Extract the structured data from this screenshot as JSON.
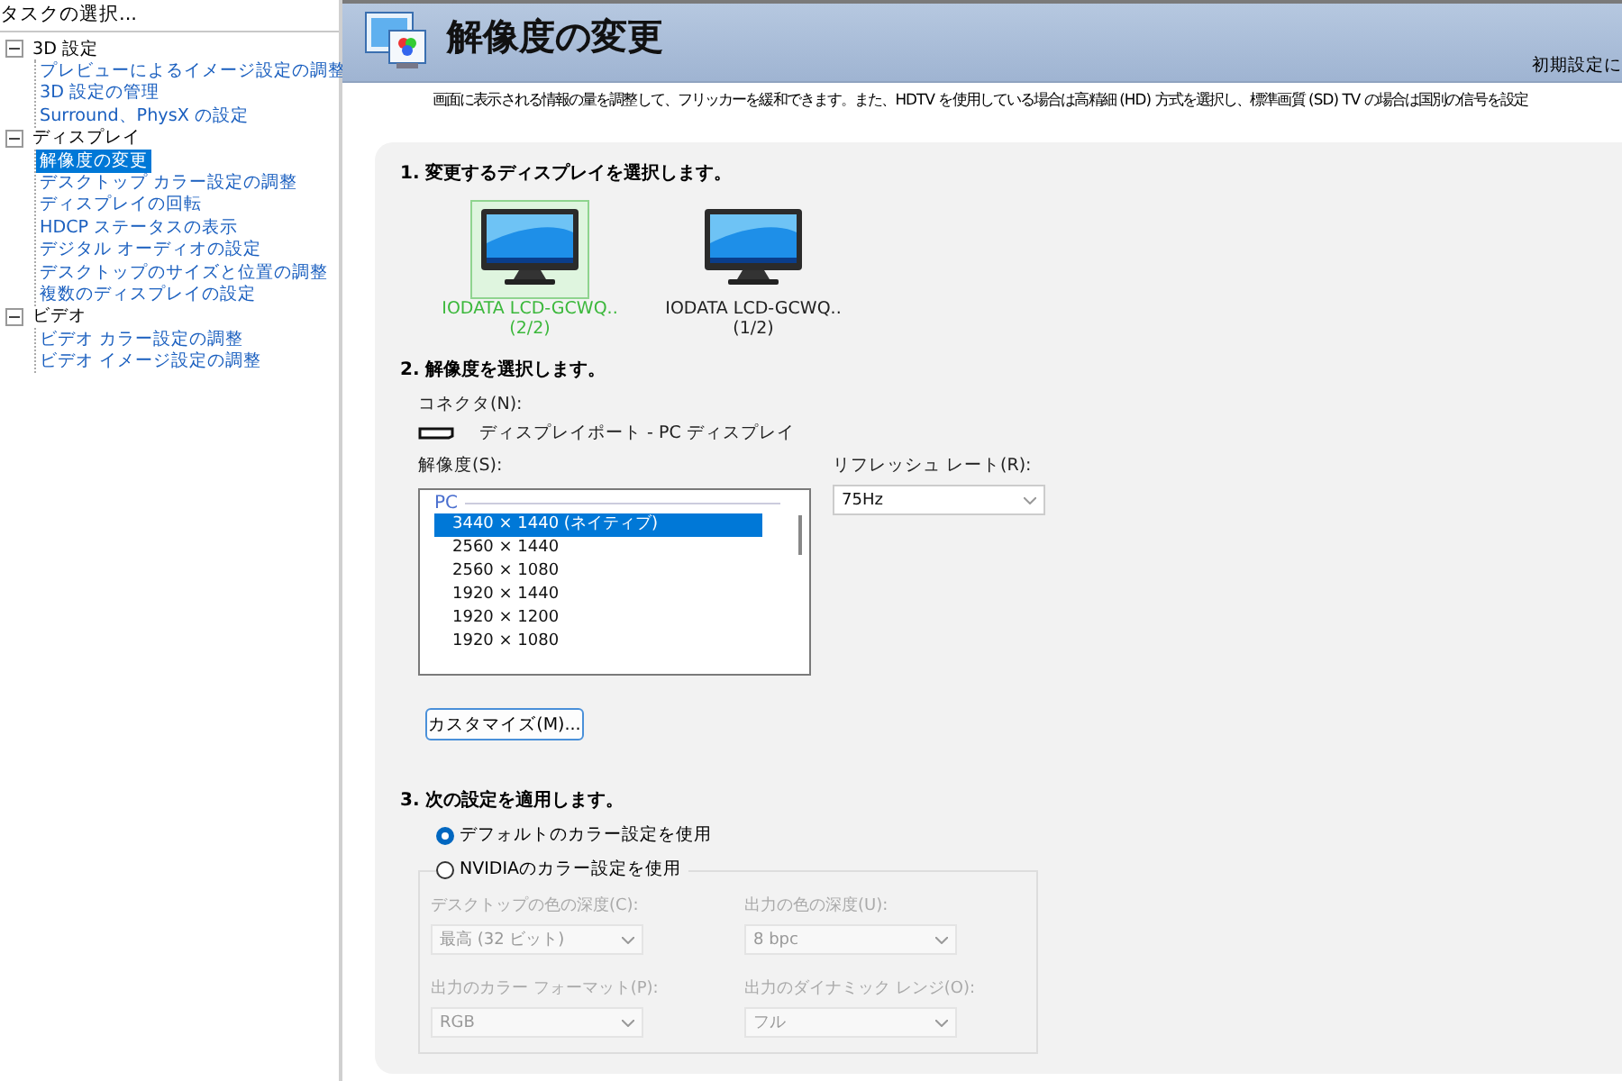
{
  "sidebar": {
    "title": "タスクの選択...",
    "tree": [
      {
        "label": "3D 設定",
        "expanded": true,
        "selected": false,
        "children": [
          {
            "label": "プレビューによるイメージ設定の調整",
            "selected": false
          },
          {
            "label": "3D 設定の管理",
            "selected": false
          },
          {
            "label": "Surround、PhysX の設定",
            "selected": false
          }
        ]
      },
      {
        "label": "ディスプレイ",
        "expanded": true,
        "selected": false,
        "children": [
          {
            "label": "解像度の変更",
            "selected": true
          },
          {
            "label": "デスクトップ カラー設定の調整",
            "selected": false
          },
          {
            "label": "ディスプレイの回転",
            "selected": false
          },
          {
            "label": "HDCP ステータスの表示",
            "selected": false
          },
          {
            "label": "デジタル オーディオの設定",
            "selected": false
          },
          {
            "label": "デスクトップのサイズと位置の調整",
            "selected": false
          },
          {
            "label": "複数のディスプレイの設定",
            "selected": false
          }
        ]
      },
      {
        "label": "ビデオ",
        "expanded": true,
        "selected": false,
        "children": [
          {
            "label": "ビデオ カラー設定の調整",
            "selected": false
          },
          {
            "label": "ビデオ イメージ設定の調整",
            "selected": false
          }
        ]
      }
    ]
  },
  "header": {
    "title": "解像度の変更",
    "restore_link": "初期設定に"
  },
  "description": "画面に表示される情報の量を調整して、フリッカーを緩和できます。また、HDTV を使用している場合は高精細 (HD) 方式を選択し、標準画質 (SD) TV の場合は国別の信号を設定",
  "section1": {
    "heading": "1. 変更するディスプレイを選択します。",
    "displays": [
      {
        "name": "IODATA LCD-GCWQ..",
        "index": "(2/2)",
        "selected": true
      },
      {
        "name": "IODATA LCD-GCWQ..",
        "index": "(1/2)",
        "selected": false
      }
    ]
  },
  "section2": {
    "heading": "2. 解像度を選択します。",
    "connector_label": "コネクタ(N):",
    "connector": "ディスプレイポート - PC ディスプレイ",
    "resolution_label": "解像度(S):",
    "resolution_group": "PC",
    "resolutions": [
      {
        "label": "3440 × 1440 (ネイティブ)",
        "selected": true
      },
      {
        "label": "2560 × 1440",
        "selected": false
      },
      {
        "label": "2560 × 1080",
        "selected": false
      },
      {
        "label": "1920 × 1440",
        "selected": false
      },
      {
        "label": "1920 × 1200",
        "selected": false
      },
      {
        "label": "1920 × 1080",
        "selected": false
      }
    ],
    "refresh_label": "リフレッシュ レート(R):",
    "refresh_value": "75Hz",
    "customize_button": "カスタマイズ(M)..."
  },
  "section3": {
    "heading": "3. 次の設定を適用します。",
    "options": [
      {
        "label": "デフォルトのカラー設定を使用",
        "selected": true
      },
      {
        "label": "NVIDIAのカラー設定を使用",
        "selected": false
      }
    ],
    "group_disabled": true,
    "fields": [
      {
        "label": "デスクトップの色の深度(C):",
        "value": "最高 (32 ビット)"
      },
      {
        "label": "出力の色の深度(U):",
        "value": "8 bpc"
      },
      {
        "label": "出力のカラー フォーマット(P):",
        "value": "RGB"
      },
      {
        "label": "出力のダイナミック レンジ(O):",
        "value": "フル"
      }
    ]
  }
}
